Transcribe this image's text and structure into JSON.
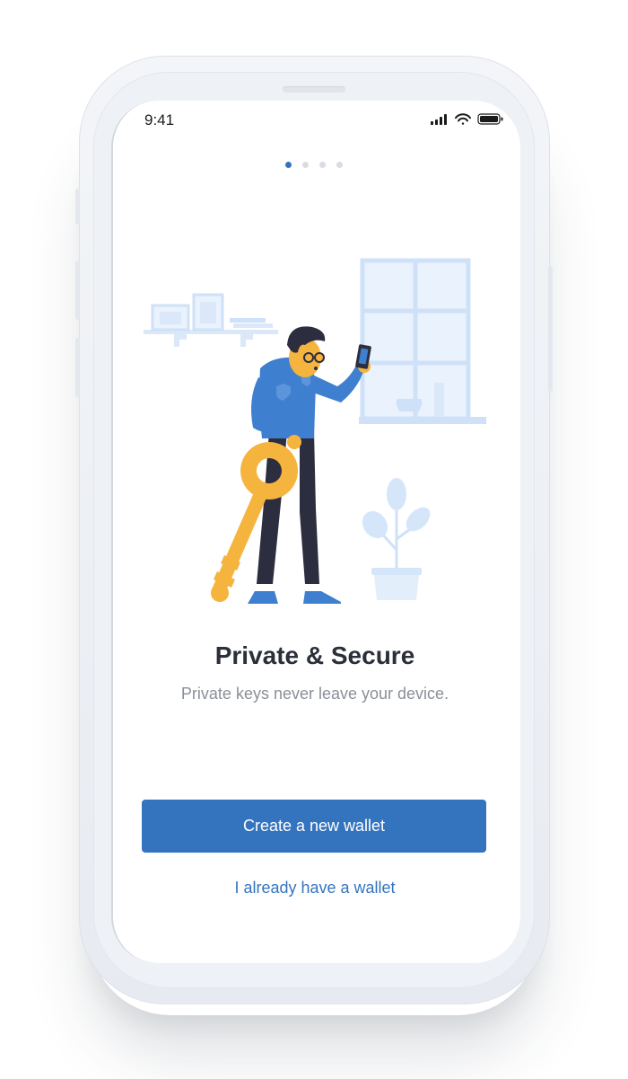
{
  "status_bar": {
    "time": "9:41",
    "icons": [
      "signal-icon",
      "wifi-icon",
      "battery-icon"
    ]
  },
  "pager": {
    "total": 4,
    "active": 1
  },
  "onboarding": {
    "title": "Private & Secure",
    "subtitle": "Private keys never leave your device.",
    "primary_button": "Create a new wallet",
    "secondary_link": "I already have a wallet"
  },
  "colors": {
    "accent": "#3474bf",
    "title": "#2b2f3a",
    "subtitle": "#8a8f98",
    "illustration_light_blue": "#cfe1f8",
    "key_yellow": "#f4b43e",
    "shirt_blue": "#3f7fd0",
    "pants_dark": "#2c2d3e"
  }
}
